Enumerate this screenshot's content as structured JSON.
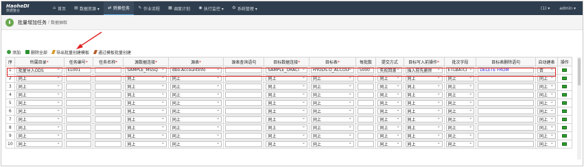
{
  "app": {
    "logo_line1": "HaoheDI",
    "logo_line2": "数据整合"
  },
  "nav": {
    "items": [
      {
        "label": "首页",
        "icon": "home-icon"
      },
      {
        "label": "数据资源 ▾",
        "icon": "database-icon"
      },
      {
        "label": "转换任务",
        "icon": "transform-icon",
        "active": true
      },
      {
        "label": "作业流程",
        "icon": "flow-icon"
      },
      {
        "label": "调度计划",
        "icon": "calendar-icon"
      },
      {
        "label": "执行监控 ▾",
        "icon": "monitor-icon"
      },
      {
        "label": "系统管理 ▾",
        "icon": "gear-icon"
      }
    ],
    "notifications": "(1) ▾",
    "user": "admin ▾"
  },
  "breadcrumb": {
    "title": "批量增加任务",
    "separator": "/",
    "sub": "数据抽取"
  },
  "toolbar": {
    "add": "添加",
    "delete_all": "删除全部",
    "export_template": "导出批量创建模板",
    "import_template": "通过模板批量创建"
  },
  "columns": [
    {
      "label": "序",
      "req": ""
    },
    {
      "label": "所属目录",
      "req": "*"
    },
    {
      "label": "任务编号",
      "req": "*"
    },
    {
      "label": "任务名称",
      "req": "*"
    },
    {
      "label": "源数据连接",
      "req": "*"
    },
    {
      "label": "源表",
      "req": "*"
    },
    {
      "label": "源表查询语句",
      "req": ""
    },
    {
      "label": "目标数据连接",
      "req": "*"
    },
    {
      "label": "目标表",
      "req": "*"
    },
    {
      "label": "每批数",
      "req": ""
    },
    {
      "label": "提交方式",
      "req": ""
    },
    {
      "label": "目标写入前操作",
      "req": "*"
    },
    {
      "label": "批次字段",
      "req": ""
    },
    {
      "label": "目标表删除语句",
      "req": ""
    },
    {
      "label": "自动建表",
      "req": ""
    },
    {
      "label": "操作",
      "req": ""
    }
  ],
  "first_row": {
    "num": "1",
    "catalog": "批量导入ODS",
    "task_no": "EL001",
    "task_name": "",
    "src_conn": "SAMPLE_MSSQ",
    "src_table": "dbo.AccountInfo",
    "src_query": "",
    "tgt_conn": "SAMPLE_ORACI",
    "tgt_table": "HYODS.O_ACCOUNT",
    "batch_size": "5000",
    "commit": "失败回滚",
    "pre_op": "插入前先删除",
    "batch_field": "ETLBATCI",
    "delete_sql": "DELETE  FROM",
    "auto_create": "否"
  },
  "repeat_rows": {
    "nums": [
      "2",
      "3",
      "4",
      "5",
      "6",
      "7",
      "8",
      "9",
      "10"
    ],
    "same": "同上"
  },
  "colors": {
    "navbar": "#2f3e4e",
    "highlight": "#e02020",
    "required": "#d9302a",
    "delete_text": "#1b1bd8"
  }
}
